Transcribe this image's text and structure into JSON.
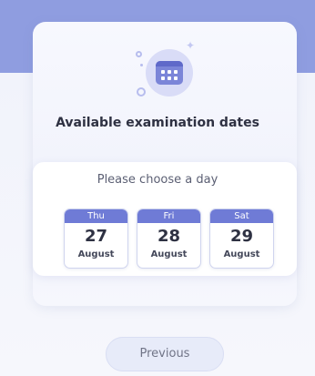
{
  "header": {
    "title": "Available examination dates",
    "illustration_icon": "calendar-icon"
  },
  "picker": {
    "prompt": "Please choose a day",
    "days": [
      {
        "weekday": "Thu",
        "day": "27",
        "month": "August"
      },
      {
        "weekday": "Fri",
        "day": "28",
        "month": "August"
      },
      {
        "weekday": "Sat",
        "day": "29",
        "month": "August"
      }
    ]
  },
  "footer": {
    "previous_label": "Previous"
  },
  "colors": {
    "accent": "#6f7bd6",
    "band": "#8f9de0"
  }
}
